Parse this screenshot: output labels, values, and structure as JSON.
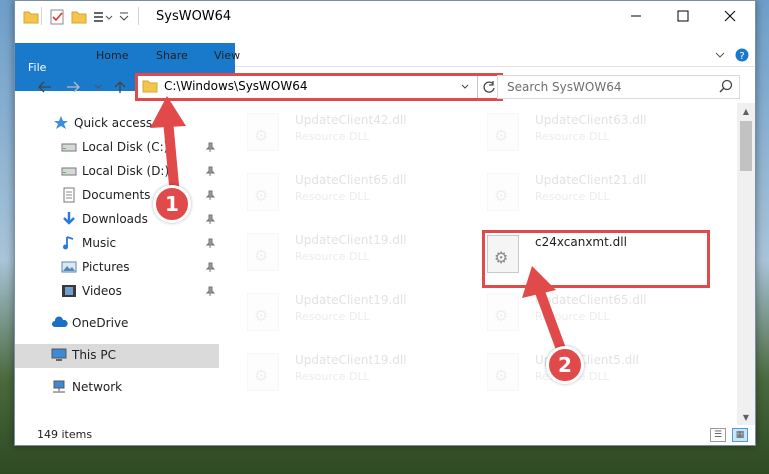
{
  "window": {
    "title": "SysWOW64"
  },
  "ribbon": {
    "tabs": [
      "File",
      "Home",
      "Share",
      "View"
    ]
  },
  "address": {
    "path": "C:\\Windows\\SysWOW64"
  },
  "search": {
    "placeholder": "Search SysWOW64"
  },
  "sidebar": {
    "items": [
      {
        "label": "Quick access",
        "icon": "star-icon",
        "pinned": false
      },
      {
        "label": "Local Disk (C:)",
        "icon": "drive-icon",
        "pinned": true
      },
      {
        "label": "Local Disk (D:)",
        "icon": "drive-icon",
        "pinned": true
      },
      {
        "label": "Documents",
        "icon": "documents-icon",
        "pinned": true
      },
      {
        "label": "Downloads",
        "icon": "download-icon",
        "pinned": true
      },
      {
        "label": "Music",
        "icon": "music-icon",
        "pinned": true
      },
      {
        "label": "Pictures",
        "icon": "pictures-icon",
        "pinned": true
      },
      {
        "label": "Videos",
        "icon": "videos-icon",
        "pinned": true
      },
      {
        "label": "OneDrive",
        "icon": "cloud-icon",
        "pinned": false
      },
      {
        "label": "This PC",
        "icon": "computer-icon",
        "pinned": false
      },
      {
        "label": "Network",
        "icon": "network-icon",
        "pinned": false
      }
    ]
  },
  "files": [
    {
      "name": "UpdateClient42.dll",
      "type": "Resource DLL"
    },
    {
      "name": "UpdateClient63.dll",
      "type": "Resource DLL"
    },
    {
      "name": "UpdateClient65.dll",
      "type": "Resource DLL"
    },
    {
      "name": "UpdateClient21.dll",
      "type": "Resource DLL"
    },
    {
      "name": "UpdateClient19.dll",
      "type": "Resource DLL"
    },
    {
      "name": "c24xcanxmt.dll",
      "type": ""
    },
    {
      "name": "UpdateClient19.dll",
      "type": "Resource DLL"
    },
    {
      "name": "UpdateClient65.dll",
      "type": "Resource DLL"
    },
    {
      "name": "UpdateClient19.dll",
      "type": "Resource DLL"
    },
    {
      "name": "UpdateClient5.dll",
      "type": "Resource DLL"
    }
  ],
  "status": {
    "items_count": "149 items"
  },
  "callouts": {
    "one": "1",
    "two": "2"
  },
  "colors": {
    "accent": "#1979ca",
    "highlight": "#e04a4a",
    "selected": "#dadada"
  }
}
